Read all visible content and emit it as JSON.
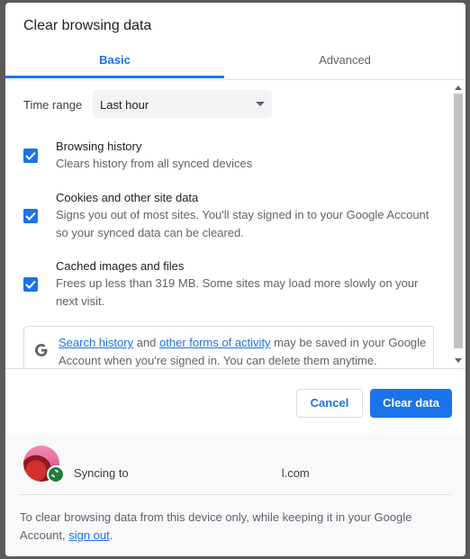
{
  "dialog": {
    "title": "Clear browsing data",
    "tabs": [
      {
        "label": "Basic",
        "selected": true
      },
      {
        "label": "Advanced",
        "selected": false
      }
    ],
    "time_range": {
      "label": "Time range",
      "value": "Last hour"
    },
    "options": [
      {
        "title": "Browsing history",
        "description": "Clears history from all synced devices",
        "checked": true
      },
      {
        "title": "Cookies and other site data",
        "description": "Signs you out of most sites. You'll stay signed in to your Google Account so your synced data can be cleared.",
        "checked": true
      },
      {
        "title": "Cached images and files",
        "description": "Frees up less than 319 MB. Some sites may load more slowly on your next visit.",
        "checked": true
      }
    ],
    "google_notice": {
      "link1": "Search history",
      "text1": " and ",
      "link2": "other forms of activity",
      "text2": " may be saved in your Google Account when you're signed in. You can delete them anytime."
    },
    "buttons": {
      "cancel": "Cancel",
      "clear": "Clear data"
    },
    "footer": {
      "sync_prefix": "Syncing to",
      "sync_suffix": "l.com",
      "note_text": "To clear browsing data from this device only, while keeping it in your Google Account, ",
      "note_link": "sign out",
      "note_end": "."
    },
    "colors": {
      "accent": "#1a73e8",
      "sync_badge": "#188038"
    }
  }
}
